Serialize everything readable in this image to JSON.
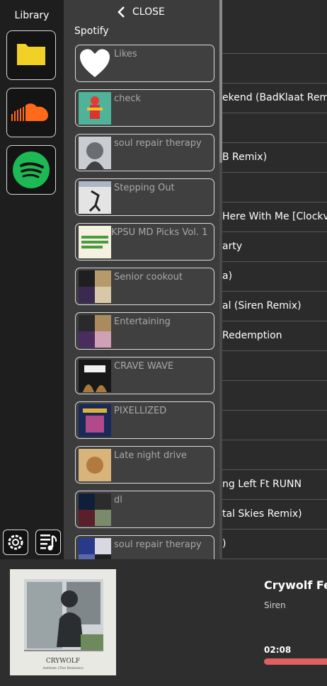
{
  "library": {
    "title": "Library",
    "sources": [
      "folder-icon",
      "soundcloud-icon",
      "spotify-icon"
    ],
    "utility": [
      "settings-icon",
      "playlist-icon"
    ]
  },
  "drawer": {
    "close_label": "CLOSE",
    "section_title": "Spotify",
    "playlists": [
      {
        "name": "Likes",
        "art": "heart"
      },
      {
        "name": "check",
        "art": "figure-green"
      },
      {
        "name": "soul repair therapy",
        "art": "sculpture"
      },
      {
        "name": "Stepping Out",
        "art": "stepping"
      },
      {
        "name": "KPSU MD Picks Vol. 1",
        "art": "gratitude"
      },
      {
        "name": "Senior cookout",
        "art": "mosaic-warm"
      },
      {
        "name": "Entertaining",
        "art": "mosaic-warm2"
      },
      {
        "name": "CRAVE WAVE",
        "art": "crave"
      },
      {
        "name": "PIXELLIZED",
        "art": "pixel"
      },
      {
        "name": "Late night drive",
        "art": "late"
      },
      {
        "name": "dl",
        "art": "mosaic-dark"
      },
      {
        "name": "soul repair therapy",
        "art": "mosaic-blue"
      }
    ]
  },
  "tracks": [
    "",
    "",
    "ekend (BadKlaat Remi",
    "",
    "B Remix)",
    "",
    "Here With Me [Clockvi",
    "arty",
    "a)",
    "al (Siren Remix)",
    " Redemption",
    "",
    "",
    "",
    "",
    "ng Left Ft RUNN",
    "tal Skies Remix)",
    ")"
  ],
  "player": {
    "title": "Crywolf Fea",
    "artist": "Siren",
    "elapsed": "02:08",
    "album_text": "CRYWOLF",
    "album_subtext": "Anthem (The Remixes)"
  },
  "colors": {
    "accent": "#e06060",
    "spotify": "#1db954",
    "soundcloud": "#ff6a1a",
    "folder": "#f5d32a"
  }
}
